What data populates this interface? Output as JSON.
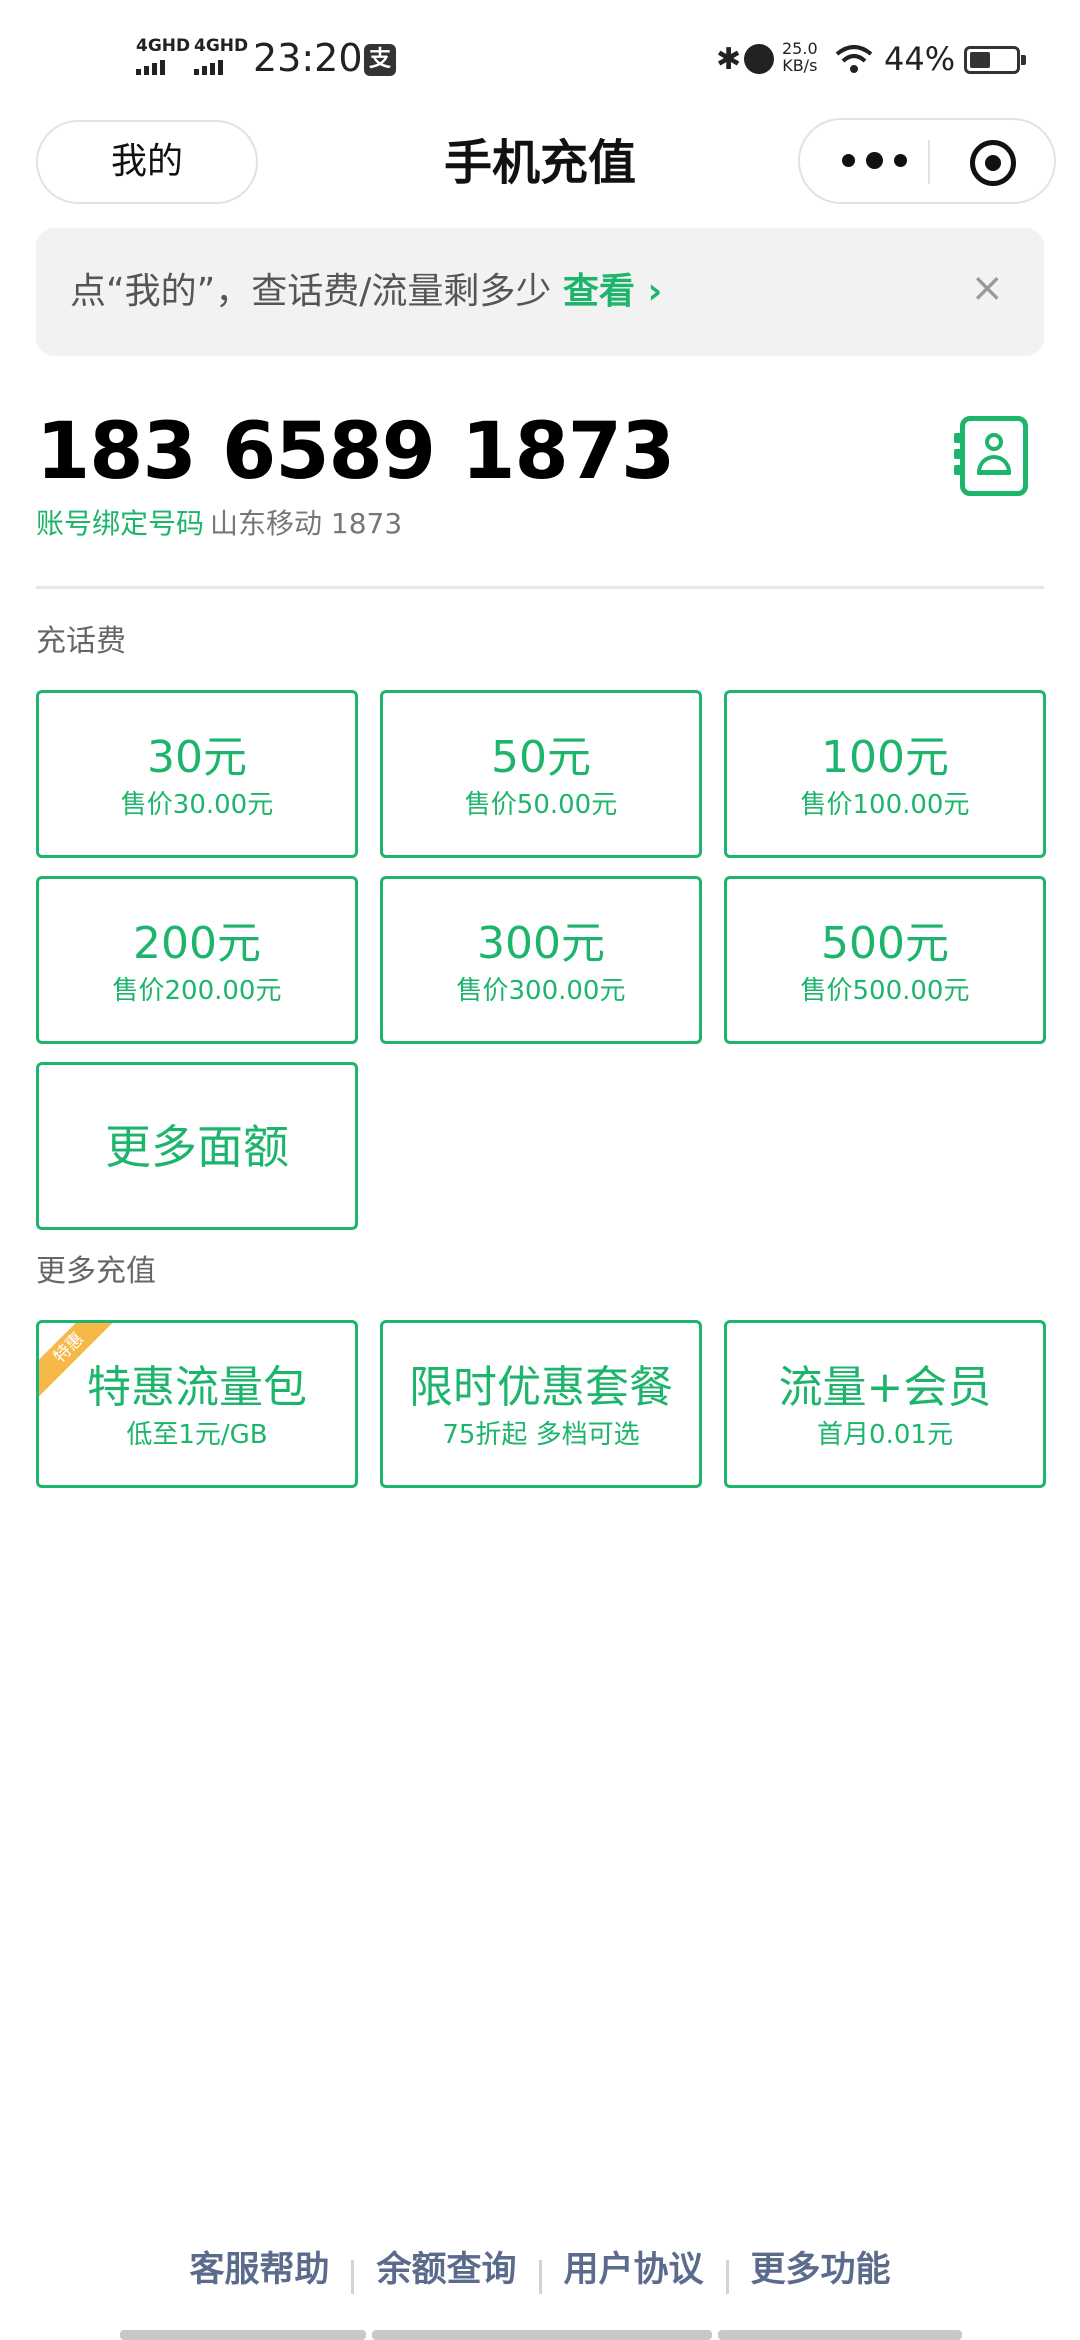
{
  "status_bar": {
    "signal1": "4GHD",
    "signal2": "4GHD",
    "time": "23:20",
    "net_speed_value": "25.0",
    "net_speed_unit": "KB/s",
    "battery": "44%"
  },
  "nav": {
    "left_button": "我的",
    "title": "手机充值"
  },
  "tip": {
    "text": "点“我的”，查话费/流量剩多少",
    "link": "查看",
    "close": "×"
  },
  "account": {
    "phone_number": "183 6589 1873",
    "bound_label": "账号绑定号码",
    "carrier_info": "山东移动 1873"
  },
  "topup": {
    "section_label": "充话费",
    "options": [
      {
        "amount": "30元",
        "price": "售价30.00元"
      },
      {
        "amount": "50元",
        "price": "售价50.00元"
      },
      {
        "amount": "100元",
        "price": "售价100.00元"
      },
      {
        "amount": "200元",
        "price": "售价200.00元"
      },
      {
        "amount": "300元",
        "price": "售价300.00元"
      },
      {
        "amount": "500元",
        "price": "售价500.00元"
      }
    ],
    "more_amounts": "更多面额"
  },
  "more": {
    "section_label": "更多充值",
    "items": [
      {
        "title": "特惠流量包",
        "desc": "低至1元/GB",
        "badge": "特惠"
      },
      {
        "title": "限时优惠套餐",
        "desc": "75折起 多档可选"
      },
      {
        "title": "流量+会员",
        "desc": "首月0.01元"
      }
    ]
  },
  "footer": {
    "links": [
      "客服帮助",
      "余额查询",
      "用户协议",
      "更多功能"
    ]
  },
  "colors": {
    "accent": "#1db56b",
    "badge": "#f7b84a",
    "footer_link": "#5b6b8c"
  },
  "icons": {
    "contact_book": "contact-book-icon",
    "close": "close-icon",
    "more": "more-dots-icon",
    "target": "target-icon",
    "chevron": "chevron-right-icon"
  }
}
